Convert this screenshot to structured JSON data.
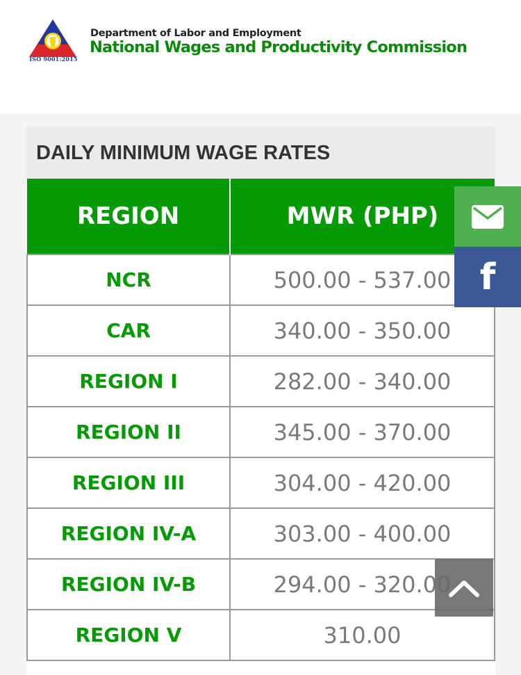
{
  "header": {
    "logo_iso": "ISO 9001:2015",
    "department": "Department of  Labor and Employment",
    "commission": "National Wages and Productivity Commission"
  },
  "colors": {
    "brand_green": "#079a07",
    "email_green": "#4fb050",
    "facebook_blue": "#3b5897"
  },
  "card": {
    "title": "DAILY MINIMUM WAGE RATES"
  },
  "table": {
    "headers": [
      "REGION",
      "MWR (PHP)"
    ],
    "rows": [
      {
        "region": "NCR",
        "rate": "500.00 - 537.00"
      },
      {
        "region": "CAR",
        "rate": "340.00 - 350.00"
      },
      {
        "region": "REGION I",
        "rate": "282.00 - 340.00"
      },
      {
        "region": "REGION II",
        "rate": "345.00 - 370.00"
      },
      {
        "region": "REGION III",
        "rate": "304.00 - 420.00"
      },
      {
        "region": "REGION IV-A",
        "rate": "303.00 - 400.00"
      },
      {
        "region": "REGION IV-B",
        "rate": "294.00 - 320.00"
      },
      {
        "region": "REGION V",
        "rate": "310.00"
      }
    ]
  },
  "share": {
    "email_icon": "envelope-icon",
    "facebook_glyph": "f",
    "back_to_top_icon": "chevron-up-icon"
  }
}
